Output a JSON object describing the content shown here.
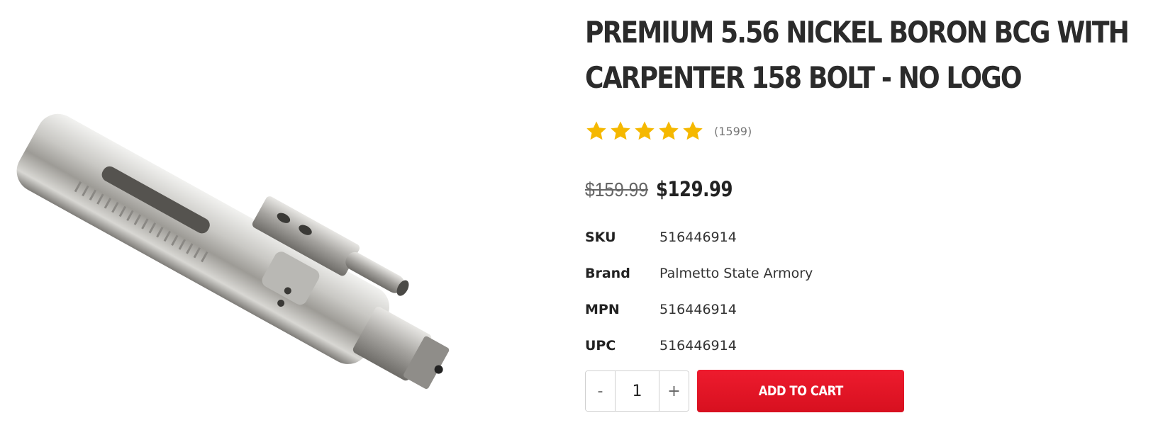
{
  "product": {
    "title": "PREMIUM 5.56 NICKEL BORON BCG WITH CARPENTER 158 BOLT - NO LOGO",
    "rating": 5,
    "rating_max": 5,
    "review_count": "(1599)",
    "old_price": "$159.99",
    "price": "$129.99",
    "image_alt": "product-photo"
  },
  "specs": [
    {
      "label": "SKU",
      "value": "516446914"
    },
    {
      "label": "Brand",
      "value": "Palmetto State Armory"
    },
    {
      "label": "MPN",
      "value": "516446914"
    },
    {
      "label": "UPC",
      "value": "516446914"
    }
  ],
  "cart": {
    "decrement_label": "-",
    "quantity": "1",
    "increment_label": "+",
    "add_label": "ADD TO CART"
  },
  "colors": {
    "star": "#f5b800",
    "button": "#e41526",
    "text": "#222222"
  }
}
